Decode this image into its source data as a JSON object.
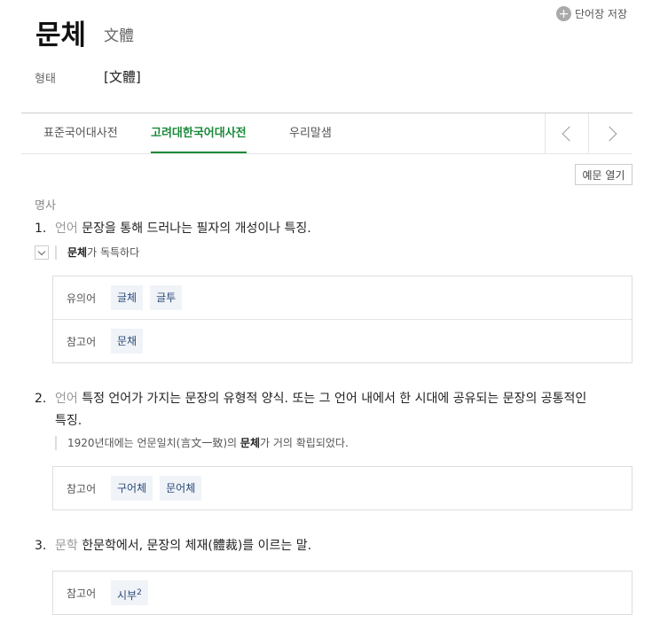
{
  "entry": {
    "headword": "문체",
    "hanja": "文體",
    "form_label": "형태",
    "form_value": "[文體]"
  },
  "save_label": "단어장 저장",
  "tabs": [
    {
      "label": "표준국어대사전",
      "active": false
    },
    {
      "label": "고려대한국어대사전",
      "active": true
    },
    {
      "label": "우리말샘",
      "active": false
    }
  ],
  "example_toggle_label": "예문 열기",
  "pos": "명사",
  "senses": [
    {
      "num": "1.",
      "domain": "언어",
      "definition": "문장을 통해 드러나는 필자의 개성이나 특징.",
      "example_bold": "문체",
      "example_rest": "가 독특하다",
      "relations": [
        {
          "label": "유의어",
          "items": [
            "글체",
            "글투"
          ]
        },
        {
          "label": "참고어",
          "items": [
            "문채"
          ]
        }
      ]
    },
    {
      "num": "2.",
      "domain": "언어",
      "definition_line1": "특정 언어가 가지는 문장의 유형적 양식. 또는 그 언어 내에서 한 시대에 공유되는 문장의 공통적인",
      "definition_line2": "특징.",
      "example_pre": "1920년대에는 언문일치(言文一致)의 ",
      "example_bold": "문체",
      "example_rest": "가 거의 확립되었다.",
      "relations": [
        {
          "label": "참고어",
          "items": [
            "구어체",
            "문어체"
          ]
        }
      ]
    },
    {
      "num": "3.",
      "domain": "문학",
      "definition": "한문학에서, 문장의 체재(體裁)를 이르는 말.",
      "relations": [
        {
          "label": "참고어",
          "items": [
            "시부"
          ],
          "sup": "2"
        }
      ]
    }
  ]
}
